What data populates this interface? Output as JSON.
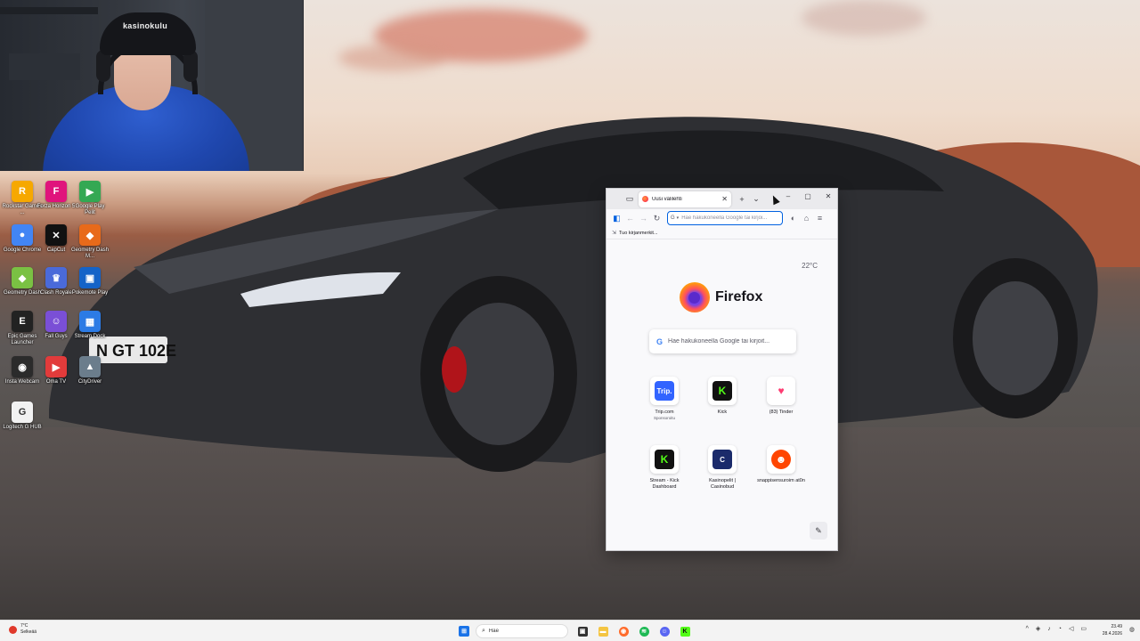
{
  "desktop": {
    "icons": [
      {
        "label": "Rockstar Games ...",
        "glyph": "R",
        "color": "#f6a800"
      },
      {
        "label": "Forza Horizon 5",
        "glyph": "F",
        "color": "#e0147c"
      },
      {
        "label": "Google Play Pelit",
        "glyph": "▶",
        "color": "#34a853"
      },
      {
        "label": "Google Chrome",
        "glyph": "●",
        "color": "#4285f4"
      },
      {
        "label": "CapCut",
        "glyph": "✕",
        "color": "#111111"
      },
      {
        "label": "Geometry Dash M...",
        "glyph": "◆",
        "color": "#e86a1a"
      },
      {
        "label": "Geometry Dash",
        "glyph": "◆",
        "color": "#7ac143"
      },
      {
        "label": "Clash Royale",
        "glyph": "♛",
        "color": "#4a6ad9"
      },
      {
        "label": "Pokemote Play",
        "glyph": "▣",
        "color": "#1463c8"
      },
      {
        "label": "Epic Games Launcher",
        "glyph": "E",
        "color": "#222222"
      },
      {
        "label": "Fall Guys",
        "glyph": "☺",
        "color": "#7a4fd6"
      },
      {
        "label": "Stream Dock",
        "glyph": "▦",
        "color": "#2c7be5"
      },
      {
        "label": "Insta Webcam",
        "glyph": "◉",
        "color": "#2b2b2b"
      },
      {
        "label": "Oma TV",
        "glyph": "▶",
        "color": "#e23b3b"
      },
      {
        "label": "CityDriver",
        "glyph": "▲",
        "color": "#6b7d8c"
      },
      {
        "label": "Logitech G HUB",
        "glyph": "G",
        "color": "#f2f2f2"
      }
    ]
  },
  "webcam": {
    "cap_text": "kasinokulu"
  },
  "browser": {
    "tab_title": "Uusi välilehti",
    "url_placeholder": "Hae hakukoneella Google tai kirjoi...",
    "url_engine": "G",
    "bookmark_label": "Tuo kirjanmerkit...",
    "weather": "22°C",
    "brand": "Firefox",
    "search_placeholder": "Hae hakukoneella Google tai kirjoit...",
    "top_sites": [
      {
        "name": "Trip.com",
        "sub": "Sponsoroitu",
        "glyph": "Trip.",
        "color": "#3264ff"
      },
      {
        "name": "Kick",
        "sub": "",
        "glyph": "K",
        "color": "#53fc18"
      },
      {
        "name": "(83) Tinder",
        "sub": "",
        "glyph": "♥",
        "color": "#fe3c72"
      },
      {
        "name": "Stream - Kick Dashboard",
        "sub": "",
        "glyph": "K",
        "color": "#53fc18"
      },
      {
        "name": "Kasinopelit | Casinobud",
        "sub": "",
        "glyph": "C",
        "color": "#1b2b6b"
      },
      {
        "name": "snappisensuroim at0n",
        "sub": "",
        "glyph": "☻",
        "color": "#ff4500"
      }
    ]
  },
  "taskbar": {
    "temp": "7°C",
    "condition": "Selkeää",
    "search_placeholder": "Hae",
    "time": "23.49",
    "date": "28.4.2026"
  }
}
